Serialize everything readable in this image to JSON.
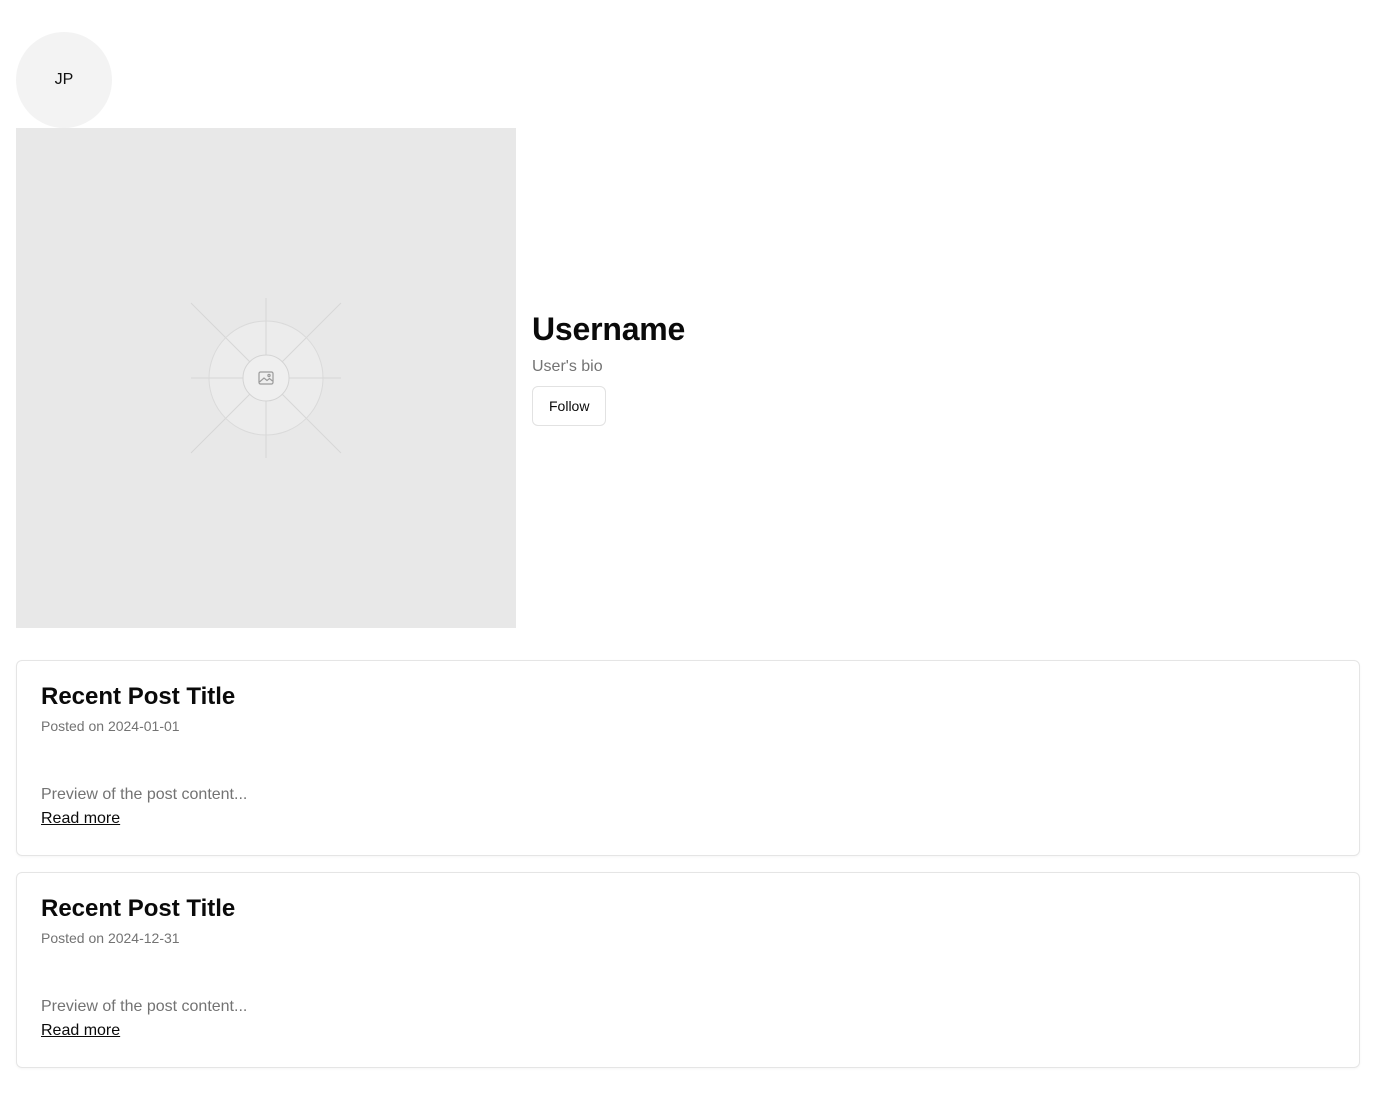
{
  "profile": {
    "avatar_initials": "JP",
    "username": "Username",
    "bio": "User's bio",
    "follow_label": "Follow",
    "cover_icon": "image-placeholder-icon"
  },
  "posts": [
    {
      "title": "Recent Post Title",
      "date": "Posted on 2024-01-01",
      "preview": "Preview of the post content...",
      "read_more": "Read more"
    },
    {
      "title": "Recent Post Title",
      "date": "Posted on 2024-12-31",
      "preview": "Preview of the post content...",
      "read_more": "Read more"
    }
  ],
  "colors": {
    "muted_text": "#737373",
    "placeholder_bg": "#e8e8e8",
    "avatar_bg": "#f3f3f3",
    "border": "#e5e5e5"
  }
}
